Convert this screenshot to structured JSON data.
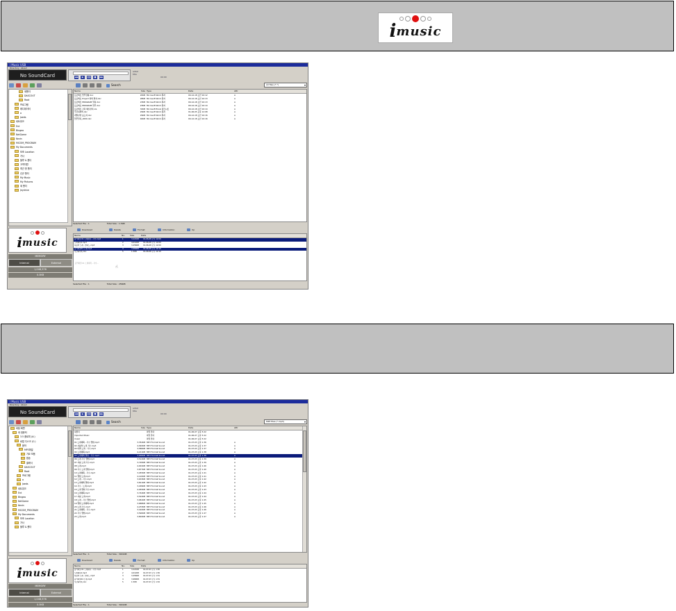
{
  "banner_top": {
    "logo_text": "music",
    "logo_letter": "i"
  },
  "banner_mid": {
    "text": ""
  },
  "app1": {
    "title": "i Music USB",
    "menu": [
      "Directory",
      "About"
    ],
    "soundcard": "No SoundCard",
    "player_info": [
      "artist",
      "title",
      "00:00"
    ],
    "search_label": "Search",
    "filter_value": "All files (*.*)",
    "tree_items": [
      "새폴더",
      "DASCOUT",
      "Root",
      "프로그램",
      "레디데이터",
      "a",
      "Joeds",
      "네트워크",
      "Ent",
      "Bingeo",
      "NetGame",
      "Kevin",
      "MICOM_PROGRAM",
      "My Documents",
      "보조 Location",
      "가사",
      "블루 & 폴더",
      "고객지원",
      "최근 한 폴더",
      "신규 폴더",
      "My Music",
      "My Pictures",
      "새 폴더",
      "Jeydrive"
    ],
    "file_headers": [
      "Name",
      "Size",
      "Type",
      "Date",
      "Attr"
    ],
    "files": [
      [
        "프로젝트 업무현황.doc",
        "20KB",
        "Microsoft Word 문서",
        "00-12-18 오전 10:12",
        "A"
      ],
      [
        "프로젝트 Project 회의 결과.doc",
        "28KB",
        "Microsoft Word 문서",
        "00-12-18 오전 10:13",
        "A"
      ],
      [
        "프로젝트 PROGRAM 일정.doc",
        "23KB",
        "Microsoft Word 문서",
        "00-12-18 오전 10:13",
        "A"
      ],
      [
        "프로젝트 PROGRAM 업무.doc",
        "23KB",
        "Microsoft Word 문서",
        "00-12-18 오전 10:14",
        "A"
      ],
      [
        "프로젝트 기획 예산관리.xls",
        "32KB",
        "Microsoft Excel 워크시트",
        "00-12-18 오전 10:14",
        "A"
      ],
      [
        "주간회의록.doc",
        "29KB",
        "Microsoft Word 문서",
        "01-06-05 오후 12:08",
        "A"
      ],
      [
        "개발관련 보고서.doc",
        "29KB",
        "Microsoft Word 문서",
        "00-12-18 오전 10:16",
        "A"
      ],
      [
        "업무일지_2000.doc",
        "46KB",
        "Microsoft Word 문서",
        "00-12-18 오전 10:16",
        "A"
      ]
    ],
    "status1_left": "Selected File : 1",
    "status1_right": "Total Size : 1.5KB",
    "side_labels": [
      "MEMORY",
      "1,048,576",
      "0.0KB"
    ],
    "btn_internal": "Internal",
    "btn_external": "External",
    "panel_toolbar": [
      "Download",
      "Delete",
      "Format",
      "Information",
      "Up"
    ],
    "dev_headers": [
      "Name",
      "No.",
      "Size",
      "Date"
    ],
    "dev_files": [
      [
        "음악파일 01 노래제목 - 가수.mp3",
        "1",
        "3,221KB",
        "01-06-08 오후 12:09",
        true
      ],
      [
        "노래제목2.mp3",
        "2",
        "4,012KB",
        "01-06-08 오후 12:09",
        false
      ],
      [
        "사랑의 노래 - 발라드.mp3",
        "3",
        "3,456KB",
        "01-06-08 오후 12:09",
        false
      ],
      [
        "음악파일04 노래.mp3",
        "4",
        "3,980KB",
        "01-06-08 오후 12:10",
        true
      ],
      [
        "주간회의록.doc",
        "5",
        "1.5KB",
        "01-06-08 오후 12:10",
        false
      ]
    ],
    "dragging_text": "음악파일 01 노래제목 - 가수...",
    "status2_left": "Selected File : 1",
    "status2_right": "Total Size : 256KB"
  },
  "app2": {
    "title": "i Music USB",
    "menu": [
      "Directory",
      "About"
    ],
    "soundcard": "No SoundCard",
    "player_info": [
      "artist",
      "title",
      "00:00"
    ],
    "search_label": "Search",
    "filter_value": "MP3 files (*.mp3)",
    "tree_items": [
      "바탕 화면",
      "내 컴퓨터",
      "3.5 플로피 (A:)",
      "로컬 디스크 (C:)",
      "음악",
      "MP3파일",
      "가요 모음",
      "팝송",
      "클래식",
      "DASCOUT",
      "Root",
      "프로그램",
      "a",
      "Joeds",
      "네트워크",
      "Ent",
      "Bingeo",
      "NetGame",
      "Kevin",
      "MICOM_PROGRAM",
      "My Documents",
      "보조 Location",
      "가사",
      "블루 & 폴더"
    ],
    "file_headers": [
      "Name",
      "Size",
      "Type",
      "Date",
      "Attr"
    ],
    "files": [
      [
        "새폴더",
        "",
        "파일 폴더",
        "01-06-07 오후 5:22",
        "",
        false
      ],
      [
        "Imported Music",
        "",
        "파일 폴더",
        "01-06-07 오후 5:22",
        "",
        false
      ],
      [
        "music",
        "",
        "파일 폴더",
        "01-06-07 오후 5:22",
        "",
        false
      ],
      [
        "01 노래제목 - 가수 앨범.mp3",
        "3,354KB",
        "MP3 Format Sound",
        "01-07-03 오후 1:36",
        "A",
        false
      ],
      [
        "02 사랑의 노래 가수.mp3",
        "4,092KB",
        "MP3 Format Sound",
        "01-07-03 오후 1:37",
        "A",
        false
      ],
      [
        "03 이별 노래 - 가수.mp3",
        "3,580KB",
        "MP3 Format Sound",
        "01-07-03 오후 1:37",
        "A",
        false
      ],
      [
        "04 노래제목.mp3",
        "4,211KB",
        "MP3 Format Sound",
        "01-07-03 오후 1:38",
        "A",
        false
      ],
      [
        "05 노래제목 앨범 - 가수.mp3",
        "3,906KB",
        "MP3 Format Sound",
        "01-07-03 오후 1:38",
        "A",
        true
      ],
      [
        "06 노래 가수 앨범.mp3",
        "3,512KB",
        "MP3 Format Sound",
        "01-07-03 오후 1:39",
        "A",
        false
      ],
      [
        "07 사랑 노래 가수.mp3",
        "3,720KB",
        "MP3 Format Sound",
        "01-07-03 오후 1:39",
        "A",
        false
      ],
      [
        "08 노래.mp3",
        "4,001KB",
        "MP3 Format Sound",
        "01-07-03 오후 1:40",
        "A",
        false
      ],
      [
        "09 가수 노래 앨범.mp3",
        "3,877KB",
        "MP3 Format Sound",
        "01-07-03 오후 1:40",
        "A",
        false
      ],
      [
        "10 노래제목 - 가수.mp3",
        "3,455KB",
        "MP3 Format Sound",
        "01-07-03 오후 1:41",
        "A",
        false
      ],
      [
        "11 앨범 노래.mp3",
        "4,120KB",
        "MP3 Format Sound",
        "01-07-03 오후 1:41",
        "A",
        false
      ],
      [
        "12 노래 - 가수.mp3",
        "3,633KB",
        "MP3 Format Sound",
        "01-07-03 오후 1:42",
        "A",
        false
      ],
      [
        "13 노래제목 앨범.mp3",
        "3,811KB",
        "MP3 Format Sound",
        "01-07-03 오후 1:42",
        "A",
        false
      ],
      [
        "14 가수 - 노래.mp3",
        "3,299KB",
        "MP3 Format Sound",
        "01-07-03 오후 1:43",
        "A",
        false
      ],
      [
        "15 노래 앨범 가수.mp3",
        "4,055KB",
        "MP3 Format Sound",
        "01-07-03 오후 1:43",
        "A",
        false
      ],
      [
        "16 노래제목.mp3",
        "3,744KB",
        "MP3 Format Sound",
        "01-07-03 오후 1:44",
        "A",
        false
      ],
      [
        "17 사랑 노래.mp3",
        "3,522KB",
        "MP3 Format Sound",
        "01-07-03 오후 1:44",
        "A",
        false
      ],
      [
        "18 노래 - 가수 앨범.mp3",
        "3,961KB",
        "MP3 Format Sound",
        "01-07-03 오후 1:45",
        "A",
        false
      ],
      [
        "19 앨범 노래제목.mp3",
        "3,688KB",
        "MP3 Format Sound",
        "01-07-03 오후 1:45",
        "A",
        false
      ],
      [
        "20 노래 가수.mp3",
        "4,233KB",
        "MP3 Format Sound",
        "01-07-03 오후 1:46",
        "A",
        false
      ],
      [
        "21 노래제목 - 가수.mp3",
        "3,410KB",
        "MP3 Format Sound",
        "01-07-03 오후 1:46",
        "A",
        false
      ],
      [
        "22 가수 앨범.mp3",
        "3,590KB",
        "MP3 Format Sound",
        "01-07-03 오후 1:47",
        "A",
        false
      ],
      [
        "23 노래.mp3",
        "3,802KB",
        "MP3 Format Sound",
        "01-07-03 오후 1:47",
        "A",
        false
      ]
    ],
    "status1_left": "Selected File : 1",
    "status1_right": "Total Size : 3901KB",
    "side_labels": [
      "MEMORY",
      "1,048,576",
      "0.0KB"
    ],
    "btn_internal": "Internal",
    "btn_external": "External",
    "panel_toolbar": [
      "Download",
      "Delete",
      "Format",
      "Information",
      "Up"
    ],
    "dev_headers": [
      "Name",
      "No.",
      "Size",
      "Date"
    ],
    "dev_files": [
      [
        "음악파일 01 노래제목 - 가수.mp3",
        "1",
        "3,221KB",
        "01-07-03 오후 1:50",
        false
      ],
      [
        "노래제목2.mp3",
        "2",
        "4,012KB",
        "01-07-03 오후 1:50",
        false
      ],
      [
        "사랑의 노래 - 발라드.mp3",
        "3",
        "3,456KB",
        "01-07-03 오후 1:51",
        false
      ],
      [
        "음악파일04 노래.mp3",
        "4",
        "3,980KB",
        "01-07-03 오후 1:51",
        false
      ],
      [
        "주간회의록.doc",
        "5",
        "1.5KB",
        "01-07-03 오후 1:52",
        false
      ]
    ],
    "status2_left": "Selected File : 1",
    "status2_right": "Total Size : 3901KB"
  },
  "colors": {
    "banner_bg": "#c0c0c0",
    "logo_red": "#e01010",
    "select_blue": "#0a1b7a",
    "app_bg": "#d4d0c8"
  }
}
